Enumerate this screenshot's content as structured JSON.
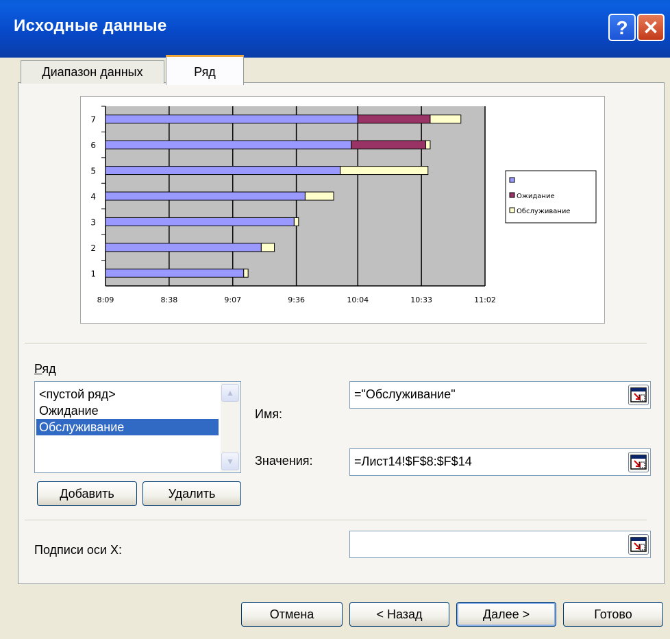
{
  "window": {
    "title": "Исходные данные",
    "help_glyph": "?",
    "close_glyph": "✕"
  },
  "tabs": [
    {
      "label": "Диапазон данных",
      "active": false
    },
    {
      "label": "Ряд",
      "active": true
    }
  ],
  "chart_data": {
    "type": "bar",
    "orientation": "horizontal",
    "stacked": true,
    "categories": [
      "1",
      "2",
      "3",
      "4",
      "5",
      "6",
      "7"
    ],
    "x_ticks": [
      "8:09",
      "8:38",
      "9:07",
      "9:36",
      "10:04",
      "10:33",
      "11:02"
    ],
    "xlim": [
      "8:09",
      "11:02"
    ],
    "series": [
      {
        "name": "",
        "color": "#9999ff",
        "start": [
          "8:09",
          "8:09",
          "8:09",
          "8:09",
          "8:09",
          "8:09",
          "8:09"
        ],
        "end": [
          "9:12",
          "9:20",
          "9:35",
          "9:40",
          "9:56",
          "10:01",
          "10:04"
        ]
      },
      {
        "name": "Ожидание",
        "color": "#993366",
        "end": [
          "9:12",
          "9:20",
          "9:35",
          "9:40",
          "9:56",
          "10:35",
          "10:37"
        ]
      },
      {
        "name": "Обслуживание",
        "color": "#ffffcc",
        "end": [
          "9:14",
          "9:26",
          "9:37",
          "9:53",
          "10:36",
          "10:37",
          "10:51"
        ]
      }
    ],
    "legend": [
      "",
      "Ожидание",
      "Обслуживание"
    ],
    "legend_position": "right",
    "grid": true,
    "plot_background": "#c0c0c0"
  },
  "series_section": {
    "label": "Ряд",
    "items": [
      "<пустой ряд>",
      "Ожидание",
      "Обслуживание"
    ],
    "selected_index": 2,
    "add_button": "Добавить",
    "delete_button": "Удалить"
  },
  "name_field": {
    "label": "Имя:",
    "value": "=\"Обслуживание\""
  },
  "values_field": {
    "label": "Значения:",
    "value": "=Лист14!$F$8:$F$14"
  },
  "xaxis_field": {
    "label": "Подписи оси X:",
    "value": ""
  },
  "buttons": {
    "cancel": "Отмена",
    "back": "< Назад",
    "next": "Далее >",
    "finish": "Готово"
  }
}
